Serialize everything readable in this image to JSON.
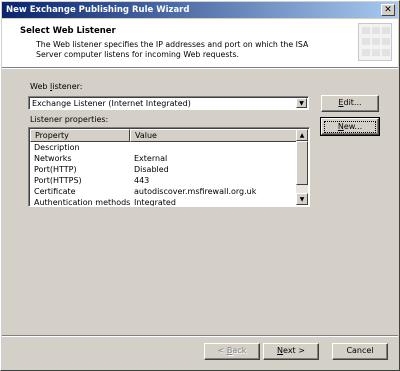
{
  "window": {
    "title": "New Exchange Publishing Rule Wizard",
    "close_glyph": "✕"
  },
  "header": {
    "title": "Select Web Listener",
    "description": "The Web listener specifies the IP addresses and port on which the ISA Server computer listens for incoming Web requests.",
    "graphic_icon": "wizard-grid-icon"
  },
  "web_listener": {
    "label_pre": "Web ",
    "label_accel": "l",
    "label_post": "istener:",
    "selected": "Exchange Listener (Internet Integrated)",
    "dropdown_icon": "chevron-down-icon"
  },
  "buttons": {
    "edit_accel": "E",
    "edit_rest": "dit...",
    "new_accel": "N",
    "new_rest": "ew...",
    "back_glyph": "< ",
    "back_accel": "B",
    "back_rest": "ack",
    "next_accel": "N",
    "next_rest": "ext >",
    "cancel": "Cancel"
  },
  "listener_properties": {
    "label": "Listener properties:",
    "columns": [
      "Property",
      "Value"
    ],
    "rows": [
      {
        "property": "Description",
        "value": ""
      },
      {
        "property": "Networks",
        "value": "External"
      },
      {
        "property": "Port(HTTP)",
        "value": "Disabled"
      },
      {
        "property": "Port(HTTPS)",
        "value": "443"
      },
      {
        "property": "Certificate",
        "value": "autodiscover.msfirewall.org.uk"
      },
      {
        "property": "Authentication methods",
        "value": "Integrated"
      }
    ],
    "scroll_up_icon": "scroll-up-icon",
    "scroll_down_icon": "scroll-down-icon"
  },
  "colors": {
    "title_gradient_start": "#0a246a",
    "title_gradient_end": "#a6caf0",
    "face": "#d4d0c8"
  }
}
